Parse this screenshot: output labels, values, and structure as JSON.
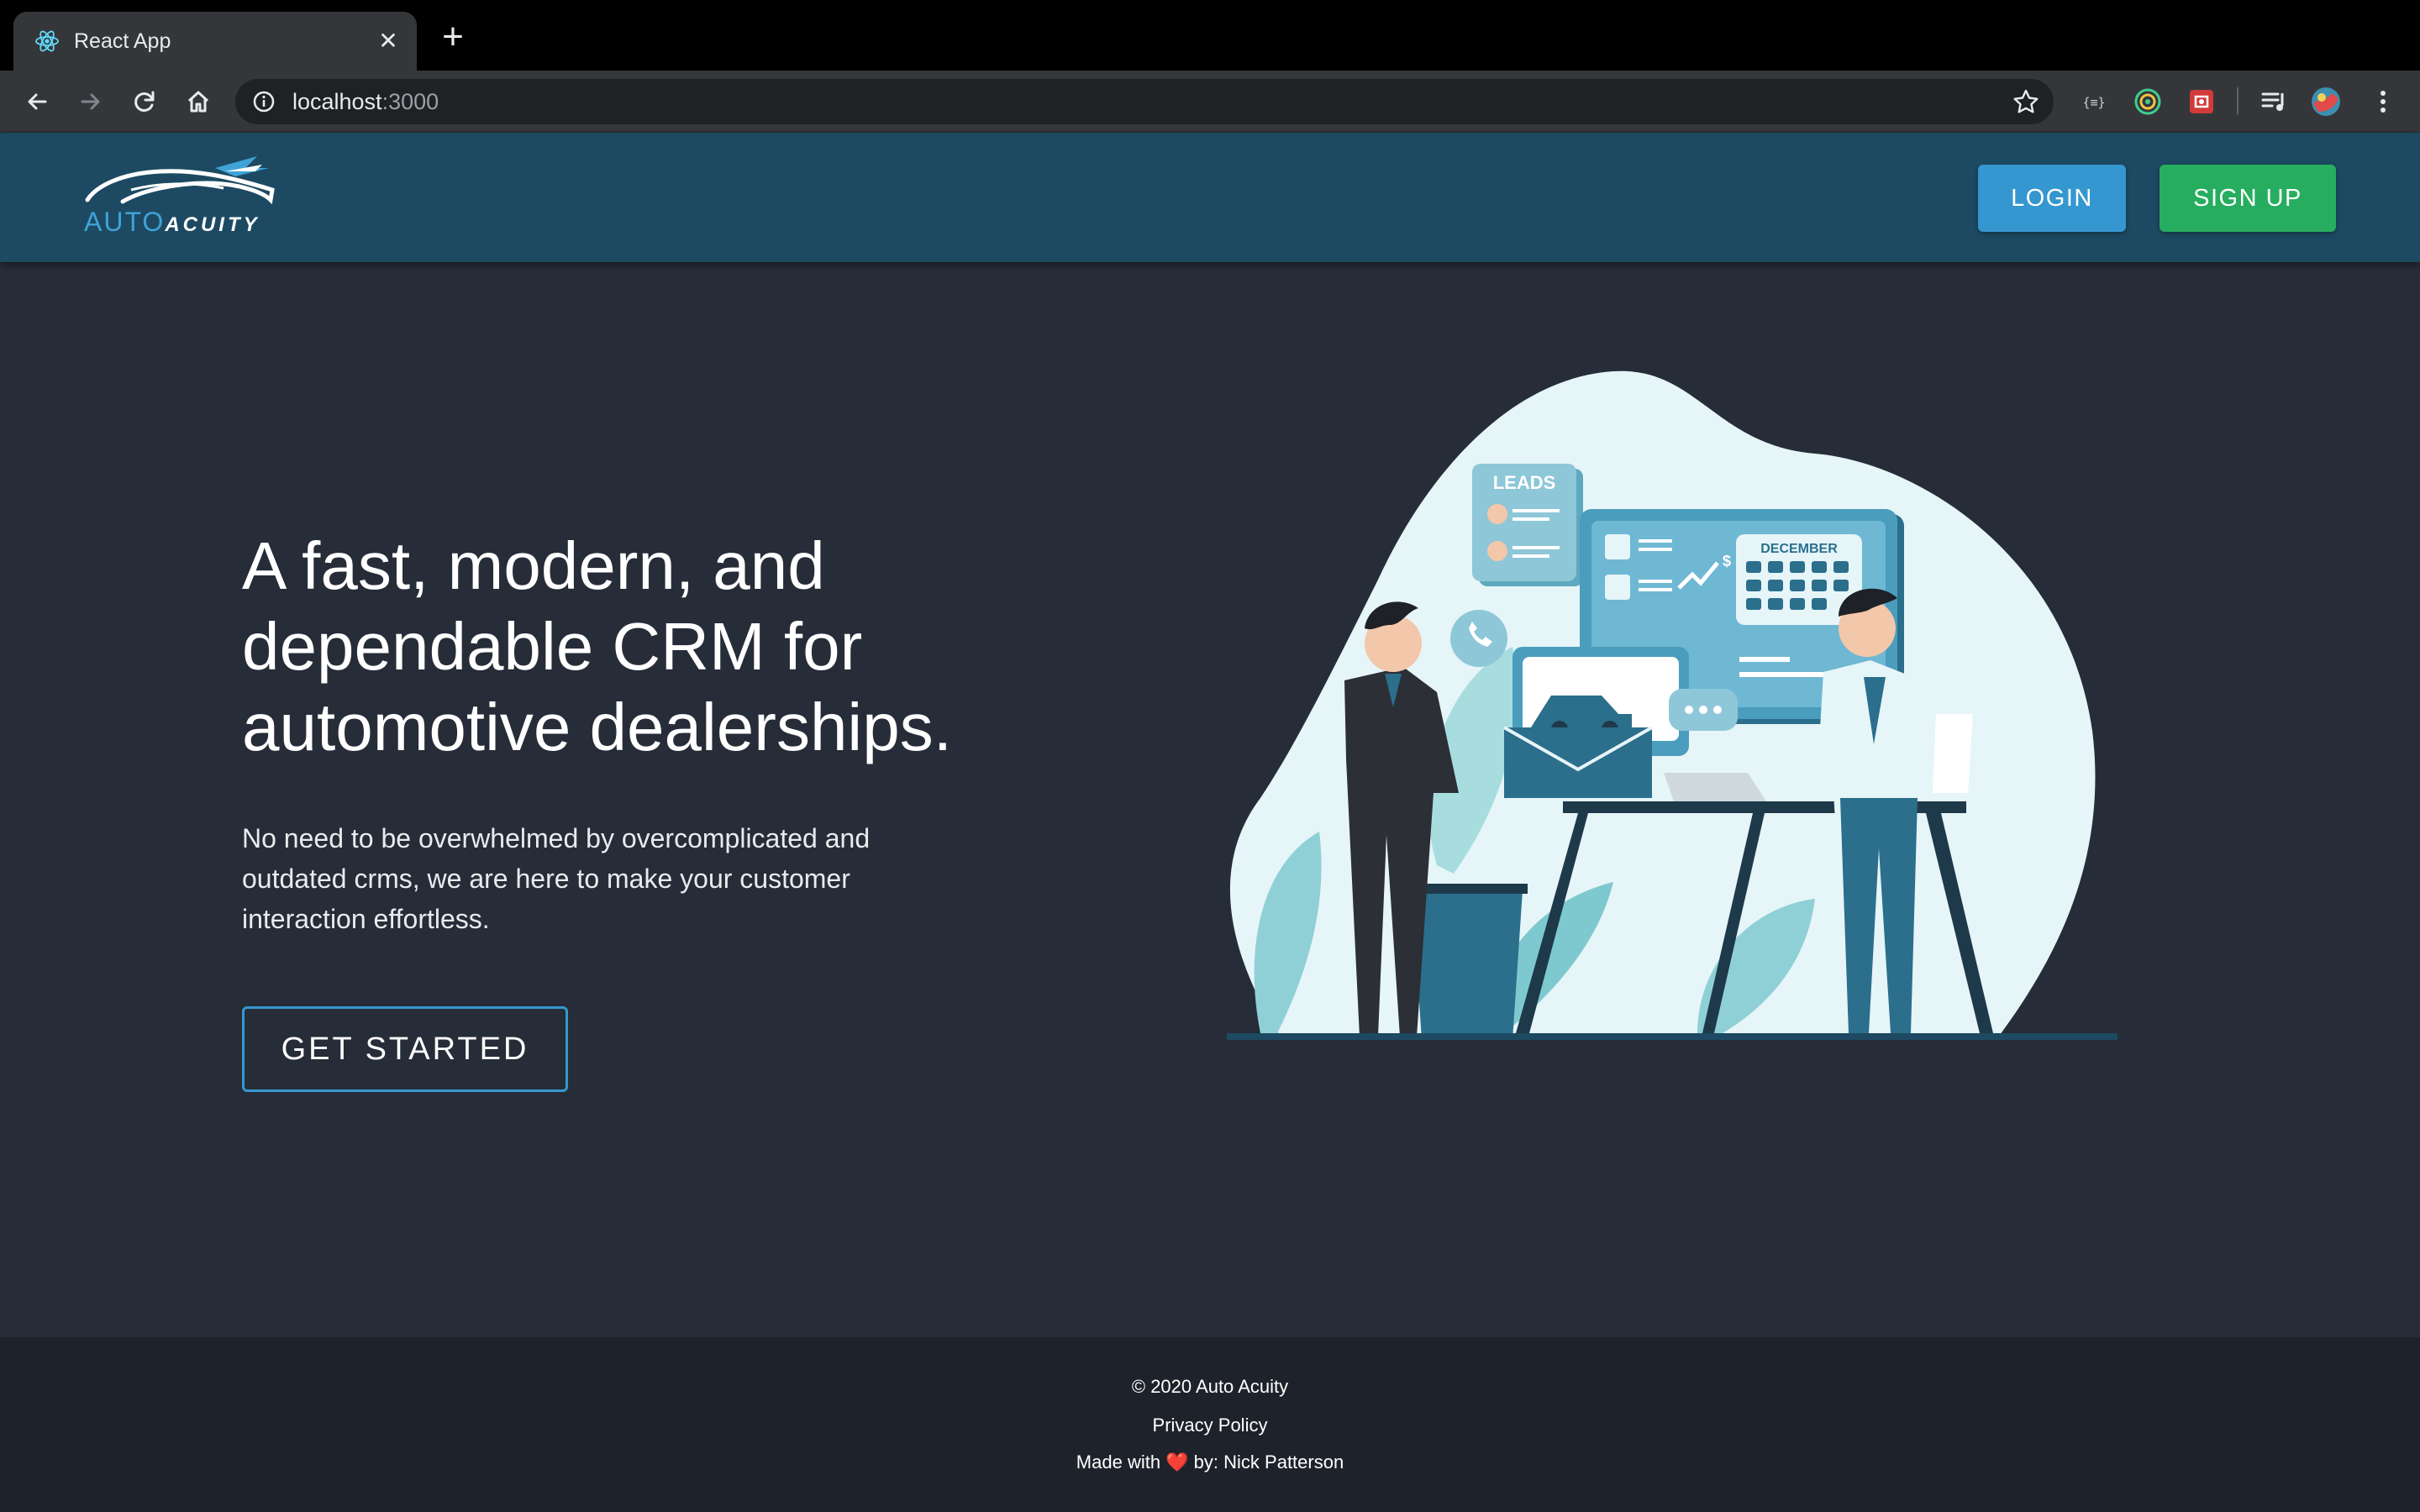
{
  "browser": {
    "tab_title": "React App",
    "tab_close_icon": "close-icon",
    "new_tab_icon": "plus-icon",
    "url_host": "localhost",
    "url_port": ":3000"
  },
  "header": {
    "logo_auto": "AUTO",
    "logo_acuity": "ACUITY",
    "login_label": "LOGIN",
    "signup_label": "SIGN UP"
  },
  "hero": {
    "title": "A fast, modern, and dependable CRM for automotive dealerships.",
    "text": "No need to be overwhelmed by overcomplicated and outdated crms, we are here to make your customer interaction effortless.",
    "cta_label": "GET STARTED"
  },
  "illustration": {
    "leads_label": "LEADS",
    "calendar_label": "DECEMBER",
    "currency_label": "$"
  },
  "footer": {
    "copyright": "© 2020 Auto Acuity",
    "privacy": "Privacy Policy",
    "made_with": "Made with ❤️  by: Nick Patterson"
  },
  "colors": {
    "header_bg": "#1d4a62",
    "page_bg": "#262d38",
    "footer_bg": "#1e232b",
    "login_bg": "#3597cf",
    "signup_bg": "#27ad5f"
  }
}
